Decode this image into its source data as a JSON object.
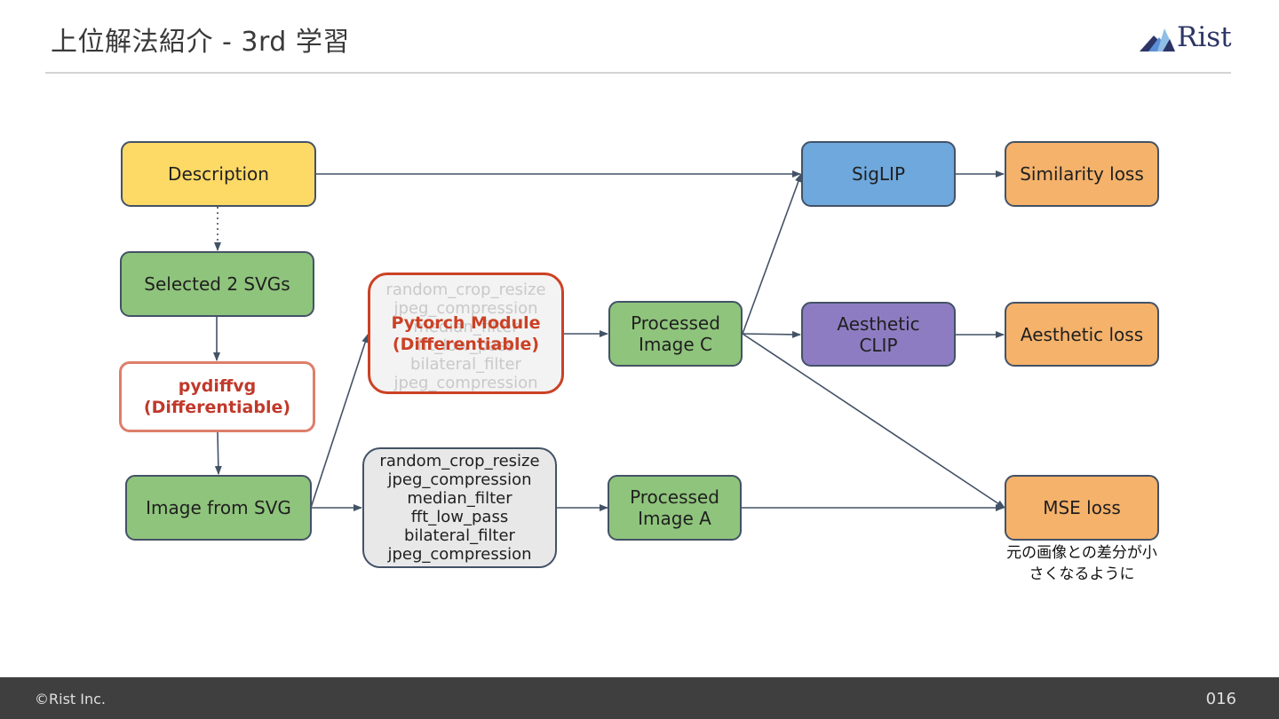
{
  "header": {
    "title": "上位解法紹介 - 3rd 学習",
    "logo_text": "Rist"
  },
  "footer": {
    "copyright": "©Rist Inc.",
    "page_number": "016"
  },
  "diagram": {
    "description": "Description",
    "selected_svgs": "Selected 2 SVGs",
    "pydiffvg": [
      "pydiffvg",
      "(Differentiable)"
    ],
    "image_from_svg": "Image from SVG",
    "pytorch_module": [
      "Pytorch Module",
      "(Differentiable)"
    ],
    "pytorch_ghost_ops": [
      "random_crop_resize",
      "jpeg_compression",
      "median_filter",
      "fft_low_pass",
      "bilateral_filter",
      "jpeg_compression"
    ],
    "augment_ops": [
      "random_crop_resize",
      "jpeg_compression",
      "median_filter",
      "fft_low_pass",
      "bilateral_filter",
      "jpeg_compression"
    ],
    "processed_c": [
      "Processed",
      "Image C"
    ],
    "processed_a": [
      "Processed",
      "Image A"
    ],
    "siglip": "SigLIP",
    "aesthetic_clip": [
      "Aesthetic",
      "CLIP"
    ],
    "similarity_loss": "Similarity loss",
    "aesthetic_loss": "Aesthetic loss",
    "mse_loss": "MSE loss",
    "mse_note": [
      "元の画像との差分が小",
      "さくなるように"
    ]
  },
  "colors": {
    "description": "#fdd966",
    "svg_nodes": "#8fc47c",
    "siglip": "#6ea8dd",
    "aesthetic_clip": "#8e7cc3",
    "losses": "#f5b26b",
    "differentiable_border": "#cc4125",
    "edge": "#435266"
  }
}
